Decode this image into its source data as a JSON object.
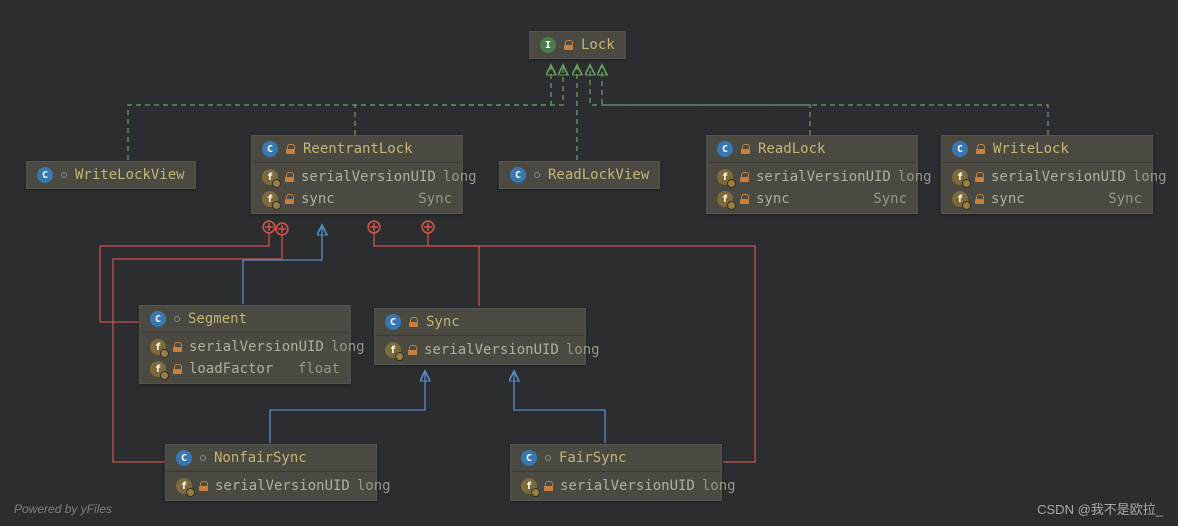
{
  "footer": "Powered by yFiles",
  "watermark": "CSDN @我不是欧拉_",
  "nodes": {
    "lock": {
      "name": "Lock"
    },
    "writeLockView": {
      "name": "WriteLockView"
    },
    "reentrantLock": {
      "name": "ReentrantLock",
      "fields": [
        {
          "name": "serialVersionUID",
          "type": "long"
        },
        {
          "name": "sync",
          "type": "Sync"
        }
      ]
    },
    "readLockView": {
      "name": "ReadLockView"
    },
    "readLock": {
      "name": "ReadLock",
      "fields": [
        {
          "name": "serialVersionUID",
          "type": "long"
        },
        {
          "name": "sync",
          "type": "Sync"
        }
      ]
    },
    "writeLock": {
      "name": "WriteLock",
      "fields": [
        {
          "name": "serialVersionUID",
          "type": "long"
        },
        {
          "name": "sync",
          "type": "Sync"
        }
      ]
    },
    "segment": {
      "name": "Segment",
      "fields": [
        {
          "name": "serialVersionUID",
          "type": "long"
        },
        {
          "name": "loadFactor",
          "type": "float"
        }
      ]
    },
    "sync": {
      "name": "Sync",
      "fields": [
        {
          "name": "serialVersionUID",
          "type": "long"
        }
      ]
    },
    "nonfairSync": {
      "name": "NonfairSync",
      "fields": [
        {
          "name": "serialVersionUID",
          "type": "long"
        }
      ]
    },
    "fairSync": {
      "name": "FairSync",
      "fields": [
        {
          "name": "serialVersionUID",
          "type": "long"
        }
      ]
    }
  }
}
